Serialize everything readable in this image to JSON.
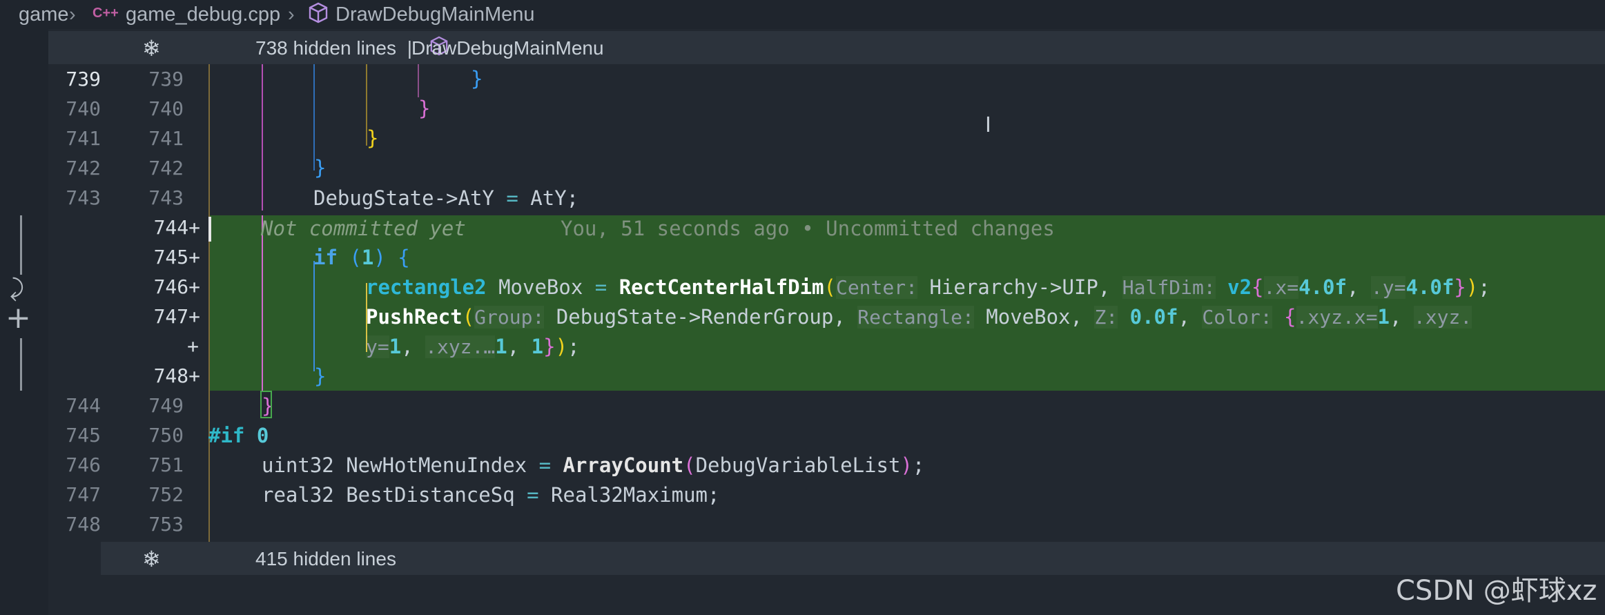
{
  "breadcrumb": {
    "root": "game",
    "file_icon": "C++",
    "file": "game_debug.cpp",
    "symbol": "DrawDebugMainMenu"
  },
  "fold_top": {
    "text": "738 hidden lines",
    "divider": "|",
    "symbol": "DrawDebugMainMenu"
  },
  "fold_bottom": {
    "text": "415 hidden lines"
  },
  "blame": {
    "author": "Not committed yet",
    "detail": "You, 51 seconds ago • Uncommitted changes"
  },
  "lines": {
    "l739a": "739",
    "l739b": "739",
    "l740a": "740",
    "l740b": "740",
    "l741a": "741",
    "l741b": "741",
    "l742a": "742",
    "l742b": "742",
    "l743a": "743",
    "l743b": "743",
    "l744b": "744+",
    "l745b": "745+",
    "l746b": "746+",
    "l747b": "747+",
    "l747c": "+",
    "l748b": "748+",
    "l744a": "744",
    "l749b": "749",
    "l745a": "745",
    "l750b": "750",
    "l746a": "746",
    "l751b": "751",
    "l747a": "747",
    "l752b": "752",
    "l748a": "748",
    "l753b": "753"
  },
  "code": {
    "debugstate": "DebugState->AtY ",
    "eq": "=",
    "aty": " AtY;",
    "if": "if",
    "one": "1",
    "rect_type": "rectangle2",
    "movebox": " MoveBox ",
    "rect_fn": "RectCenterHalfDim",
    "hint_center": "Center:",
    "hierarchy": " Hierarchy->UIP, ",
    "hint_halfdim": "HalfDim:",
    "v2": " v2",
    "dot_x": ".x=",
    "val_4a": "4.0f",
    "dot_y": ".y=",
    "val_4b": "4.0f",
    "pushrect": "PushRect",
    "hint_group": "Group:",
    "rendergroup": " DebugState->RenderGroup, ",
    "hint_rect": "Rectangle:",
    "movebox2": " MoveBox, ",
    "hint_z": "Z:",
    "val_0": " 0.0f",
    "hint_color": "Color:",
    "xyzx": ".xyz.x=",
    "xyz_dot": ".xyz.",
    "y_eq": "y=",
    "xyz_ellipsis": ".xyz.…",
    "preif": "#if",
    "zero": " 0",
    "uint32": "uint32 NewHotMenuIndex ",
    "arraycount": "ArrayCount",
    "dvl": "DebugVariableList",
    "real32": "real32 BestDistanceSq ",
    "real32max": " Real32Maximum;"
  },
  "watermark": "CSDN @虾球xz",
  "colors": {
    "added_background": "#2c5a29",
    "editor_background": "#222830"
  }
}
